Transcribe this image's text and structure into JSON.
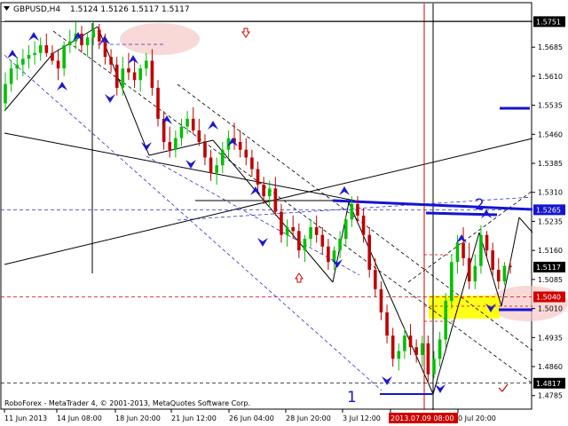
{
  "header": {
    "symbol": "GBPUSD,H4",
    "ohlc": "1.5124 1.5126 1.5117 1.5117"
  },
  "footer_text": "RoboForex - MetaTrader 4, © 2001-2013, MetaQuotes Software Corp.",
  "markers": {
    "wave_1": "1",
    "wave_2": "2"
  },
  "colors": {
    "bull": "#00c000",
    "bear": "#c00000",
    "trendline_blue": "#1515d0",
    "dashed_blue": "#3030c8",
    "dashed_red": "#d00000",
    "target_yellow": "#ffff00",
    "pink_zone": "#f7c8c8",
    "axis_text": "#000000",
    "price_tag_bg": "#000000",
    "price_tag_fg": "#ffffff",
    "date_tag_bg": "#d00000"
  },
  "chart_data": {
    "type": "candlestick",
    "title": "GBPUSD,H4",
    "ylim": [
      1.475,
      1.58
    ],
    "y_ticks": [
      "1.5685",
      "1.5610",
      "1.5535",
      "1.5460",
      "1.5385",
      "1.5310",
      "1.5235",
      "1.5160",
      "1.5085",
      "1.5010",
      "1.4935",
      "1.4860",
      "1.4785"
    ],
    "x_ticks": [
      "11 Jun 2013",
      "14 Jun 08:00",
      "18 Jun 20:00",
      "21 Jun 12:00",
      "26 Jun 04:00",
      "28 Jun 20:00",
      "3 Jul 12:00",
      "2013.07.09 08:00",
      "0 Jul 20:00"
    ],
    "price_tags": [
      {
        "label": "1.5751",
        "value": 1.5751,
        "style": "black"
      },
      {
        "label": "1.5265",
        "value": 1.5265,
        "style": "blue"
      },
      {
        "label": "1.5117",
        "value": 1.5117,
        "style": "black"
      },
      {
        "label": "1.5040",
        "value": 1.504,
        "style": "red"
      },
      {
        "label": "1.4817",
        "value": 1.4817,
        "style": "black"
      }
    ],
    "horizontal_lines": [
      {
        "value": 1.5751,
        "style": "solid-black"
      },
      {
        "value": 1.5265,
        "style": "dashed-blue"
      },
      {
        "value": 1.504,
        "style": "dashed-red"
      },
      {
        "value": 1.4817,
        "style": "dashed-black"
      }
    ],
    "ohlc": [
      [
        1.554,
        1.562,
        1.552,
        1.559
      ],
      [
        1.559,
        1.565,
        1.557,
        1.563
      ],
      [
        1.563,
        1.566,
        1.56,
        1.564
      ],
      [
        1.564,
        1.568,
        1.561,
        1.5655
      ],
      [
        1.5655,
        1.569,
        1.563,
        1.5665
      ],
      [
        1.5665,
        1.57,
        1.564,
        1.567
      ],
      [
        1.567,
        1.571,
        1.565,
        1.569
      ],
      [
        1.569,
        1.572,
        1.566,
        1.567
      ],
      [
        1.567,
        1.569,
        1.564,
        1.565
      ],
      [
        1.565,
        1.568,
        1.56,
        1.563
      ],
      [
        1.563,
        1.57,
        1.561,
        1.569
      ],
      [
        1.569,
        1.573,
        1.567,
        1.57
      ],
      [
        1.57,
        1.575,
        1.568,
        1.572
      ],
      [
        1.572,
        1.574,
        1.567,
        1.569
      ],
      [
        1.569,
        1.572,
        1.566,
        1.571
      ],
      [
        1.571,
        1.5751,
        1.569,
        1.573
      ],
      [
        1.573,
        1.5745,
        1.568,
        1.57
      ],
      [
        1.57,
        1.572,
        1.564,
        1.566
      ],
      [
        1.566,
        1.568,
        1.562,
        1.564
      ],
      [
        1.564,
        1.566,
        1.556,
        1.558
      ],
      [
        1.558,
        1.566,
        1.556,
        1.563
      ],
      [
        1.563,
        1.567,
        1.56,
        1.562
      ],
      [
        1.562,
        1.565,
        1.558,
        1.56
      ],
      [
        1.56,
        1.564,
        1.557,
        1.563
      ],
      [
        1.563,
        1.567,
        1.561,
        1.565
      ],
      [
        1.565,
        1.568,
        1.556,
        1.558
      ],
      [
        1.558,
        1.56,
        1.548,
        1.55
      ],
      [
        1.55,
        1.552,
        1.542,
        1.544
      ],
      [
        1.544,
        1.548,
        1.54,
        1.542
      ],
      [
        1.542,
        1.547,
        1.54,
        1.545
      ],
      [
        1.545,
        1.55,
        1.543,
        1.548
      ],
      [
        1.548,
        1.552,
        1.546,
        1.55
      ],
      [
        1.55,
        1.553,
        1.546,
        1.547
      ],
      [
        1.547,
        1.55,
        1.543,
        1.544
      ],
      [
        1.544,
        1.546,
        1.538,
        1.54
      ],
      [
        1.54,
        1.542,
        1.534,
        1.536
      ],
      [
        1.536,
        1.54,
        1.533,
        1.538
      ],
      [
        1.538,
        1.544,
        1.536,
        1.542
      ],
      [
        1.542,
        1.547,
        1.54,
        1.545
      ],
      [
        1.545,
        1.549,
        1.542,
        1.544
      ],
      [
        1.544,
        1.547,
        1.54,
        1.542
      ],
      [
        1.542,
        1.545,
        1.538,
        1.54
      ],
      [
        1.54,
        1.542,
        1.535,
        1.537
      ],
      [
        1.537,
        1.539,
        1.531,
        1.533
      ],
      [
        1.533,
        1.535,
        1.528,
        1.53
      ],
      [
        1.53,
        1.534,
        1.527,
        1.532
      ],
      [
        1.532,
        1.535,
        1.525,
        1.526
      ],
      [
        1.526,
        1.528,
        1.518,
        1.52
      ],
      [
        1.52,
        1.524,
        1.517,
        1.522
      ],
      [
        1.522,
        1.525,
        1.519,
        1.521
      ],
      [
        1.521,
        1.523,
        1.514,
        1.516
      ],
      [
        1.516,
        1.52,
        1.513,
        1.519
      ],
      [
        1.519,
        1.524,
        1.517,
        1.522
      ],
      [
        1.522,
        1.525,
        1.518,
        1.52
      ],
      [
        1.52,
        1.522,
        1.515,
        1.517
      ],
      [
        1.517,
        1.519,
        1.511,
        1.513
      ],
      [
        1.513,
        1.517,
        1.511,
        1.516
      ],
      [
        1.516,
        1.521,
        1.514,
        1.519
      ],
      [
        1.519,
        1.525,
        1.517,
        1.524
      ],
      [
        1.524,
        1.53,
        1.522,
        1.528
      ],
      [
        1.528,
        1.53,
        1.523,
        1.525
      ],
      [
        1.525,
        1.527,
        1.518,
        1.52
      ],
      [
        1.52,
        1.522,
        1.509,
        1.511
      ],
      [
        1.511,
        1.514,
        1.504,
        1.506
      ],
      [
        1.506,
        1.508,
        1.498,
        1.5
      ],
      [
        1.5,
        1.502,
        1.492,
        1.494
      ],
      [
        1.494,
        1.496,
        1.486,
        1.488
      ],
      [
        1.488,
        1.492,
        1.485,
        1.49
      ],
      [
        1.49,
        1.496,
        1.488,
        1.494
      ],
      [
        1.494,
        1.497,
        1.489,
        1.491
      ],
      [
        1.491,
        1.493,
        1.487,
        1.489
      ],
      [
        1.489,
        1.494,
        1.486,
        1.492
      ],
      [
        1.492,
        1.494,
        1.4817,
        1.484
      ],
      [
        1.484,
        1.49,
        1.483,
        1.488
      ],
      [
        1.488,
        1.495,
        1.486,
        1.493
      ],
      [
        1.493,
        1.505,
        1.491,
        1.503
      ],
      [
        1.503,
        1.515,
        1.501,
        1.513
      ],
      [
        1.513,
        1.52,
        1.51,
        1.518
      ],
      [
        1.518,
        1.522,
        1.512,
        1.514
      ],
      [
        1.514,
        1.518,
        1.506,
        1.508
      ],
      [
        1.508,
        1.515,
        1.506,
        1.512
      ],
      [
        1.512,
        1.5225,
        1.51,
        1.52
      ],
      [
        1.52,
        1.521,
        1.514,
        1.516
      ],
      [
        1.516,
        1.518,
        1.509,
        1.511
      ],
      [
        1.511,
        1.514,
        1.506,
        1.508
      ],
      [
        1.508,
        1.513,
        1.507,
        1.512
      ],
      [
        1.512,
        1.5135,
        1.51,
        1.5117
      ]
    ]
  }
}
